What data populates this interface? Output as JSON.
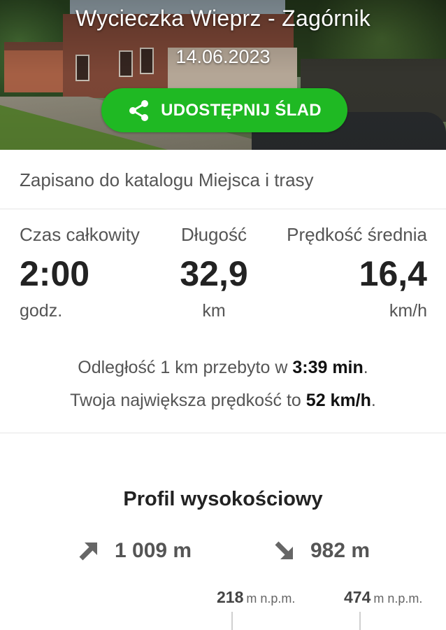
{
  "hero": {
    "title": "Wycieczka Wieprz - Zagórnik",
    "date": "14.06.2023",
    "share_label": "UDOSTĘPNIJ ŚLAD"
  },
  "catalog": {
    "text": "Zapisano do katalogu Miejsca i trasy"
  },
  "stats": {
    "total_time": {
      "label": "Czas całkowity",
      "value": "2:00",
      "unit": "godz."
    },
    "distance": {
      "label": "Długość",
      "value": "32,9",
      "unit": "km"
    },
    "avg_speed": {
      "label": "Prędkość średnia",
      "value": "16,4",
      "unit": "km/h"
    }
  },
  "info": {
    "line1_prefix": "Odległość 1 km przebyto w ",
    "line1_value": "3:39 min",
    "line1_suffix": ".",
    "line2_prefix": "Twoja największa prędkość to ",
    "line2_value": "52 km/h",
    "line2_suffix": "."
  },
  "profile": {
    "title": "Profil wysokościowy",
    "ascent": "1 009 m",
    "descent": "982 m",
    "alt_min_value": "218",
    "alt_min_unit": "m n.p.m.",
    "alt_max_value": "474",
    "alt_max_unit": "m n.p.m."
  },
  "colors": {
    "accent_green": "#1fb923"
  }
}
